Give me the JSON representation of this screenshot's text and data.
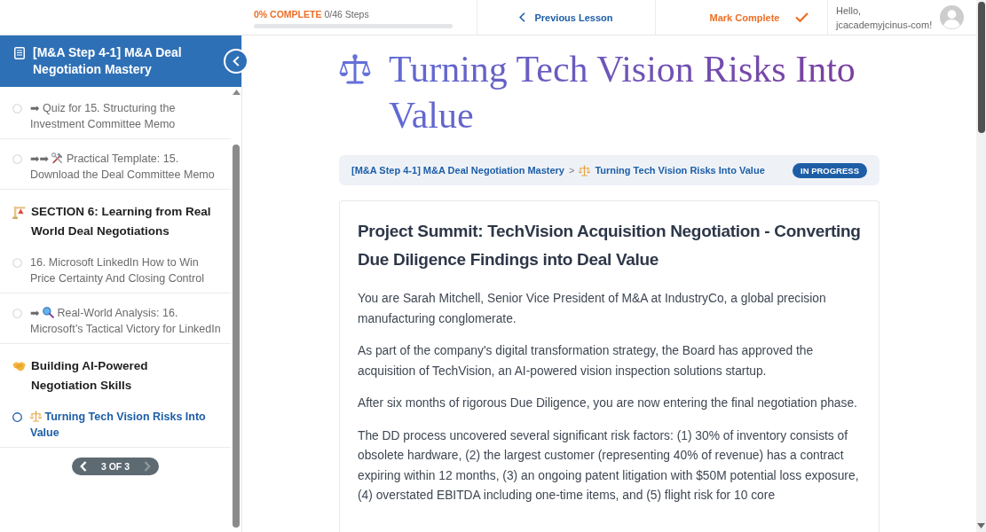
{
  "progress": {
    "percent": "0% COMPLETE",
    "steps": "0/46 Steps"
  },
  "nav": {
    "previous_lesson": "Previous Lesson",
    "mark_complete": "Mark Complete"
  },
  "user": {
    "greeting": "Hello,",
    "name": "jcacademyjcinus-com!"
  },
  "sidebar": {
    "course_title": "[M&A Step 4-1] M&A Deal Negotiation Mastery",
    "items": [
      {
        "kind": "lesson",
        "prefix": "➡",
        "label": "Quiz for 15. Structuring the Investment Committee Memo",
        "selected": false
      },
      {
        "kind": "lesson",
        "prefix": "➡➡",
        "label": "Practical Template: 15. Download the Deal Committee Memo",
        "selected": false
      },
      {
        "kind": "section",
        "label": "SECTION 6: Learning from Real World Deal Negotiations"
      },
      {
        "kind": "lesson",
        "label": "16. Microsoft LinkedIn How to Win Price Certainty And Closing Control",
        "selected": false
      },
      {
        "kind": "lesson",
        "prefix": "➡",
        "label": "Real-World Analysis: 16. Microsoft’s Tactical Victory for LinkedIn",
        "selected": false
      },
      {
        "kind": "section",
        "label": "Building AI-Powered Negotiation Skills"
      },
      {
        "kind": "lesson",
        "label": "Turning Tech Vision Risks Into Value",
        "selected": true
      }
    ],
    "pagination": {
      "label": "3 OF 3",
      "previous_disabled": false,
      "next_disabled": true
    }
  },
  "title": "Turning Tech Vision Risks Into Value",
  "breadcrumb": {
    "course": "[M&A Step 4-1] M&A Deal Negotiation Mastery",
    "separator": ">",
    "lesson": "Turning Tech Vision Risks Into Value",
    "status": "IN PROGRESS"
  },
  "article": {
    "heading": "Project Summit: TechVision Acquisition Negotiation - Converting Due Diligence Findings into Deal Value",
    "paragraphs": [
      "You are Sarah Mitchell, Senior Vice President of M&A at IndustryCo, a global precision manufacturing conglomerate.",
      "As part of the company's digital transformation strategy, the Board has approved the acquisition of TechVision, an AI-powered vision inspection solutions startup.",
      "After six months of rigorous Due Diligence, you are now entering the final negotiation phase.",
      "The DD process uncovered several significant risk factors: (1) 30% of inventory consists of obsolete hardware, (2) the largest customer (representing 40% of revenue) has a contract expiring within 12 months, (3) an ongoing patent litigation with $50M potential loss exposure, (4) overstated EBITDA including one-time items, and (5) flight risk for 10 core"
    ]
  }
}
